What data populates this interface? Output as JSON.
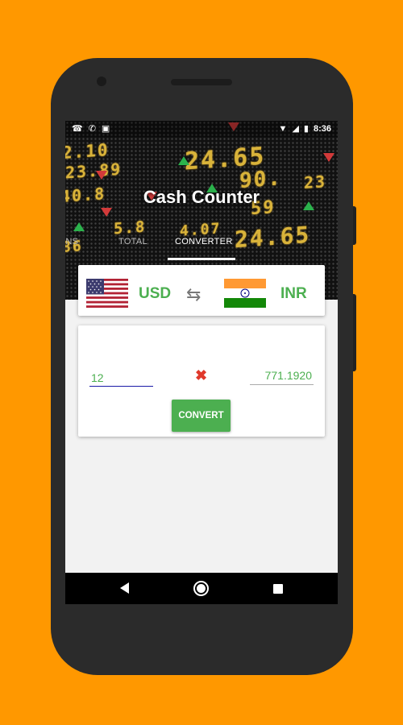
{
  "status_bar": {
    "time": "8:36",
    "left_icons": [
      "whatsapp-icon",
      "phone-icon",
      "image-icon"
    ],
    "right_icons": [
      "wifi-icon",
      "signal-icon",
      "battery-icon"
    ]
  },
  "app": {
    "title": "Cash Counter"
  },
  "tabs": [
    {
      "label": "INS"
    },
    {
      "label": "TOTAL"
    },
    {
      "label": "CONVERTER",
      "active": true
    }
  ],
  "converter": {
    "from_code": "USD",
    "to_code": "INR",
    "from_flag": "us-flag",
    "to_flag": "india-flag",
    "swap_icon": "swap-arrows-icon",
    "amount_value": "12",
    "result_value": "771.1920",
    "clear_icon": "clear-x-icon",
    "convert_label": "CONVERT"
  },
  "nav": {
    "icons": [
      "back-icon",
      "home-icon",
      "recents-icon"
    ]
  },
  "colors": {
    "background": "#FF9800",
    "accent": "#4CAF50",
    "clear": "#E0392B",
    "input_underline": "#1A1AA8"
  }
}
